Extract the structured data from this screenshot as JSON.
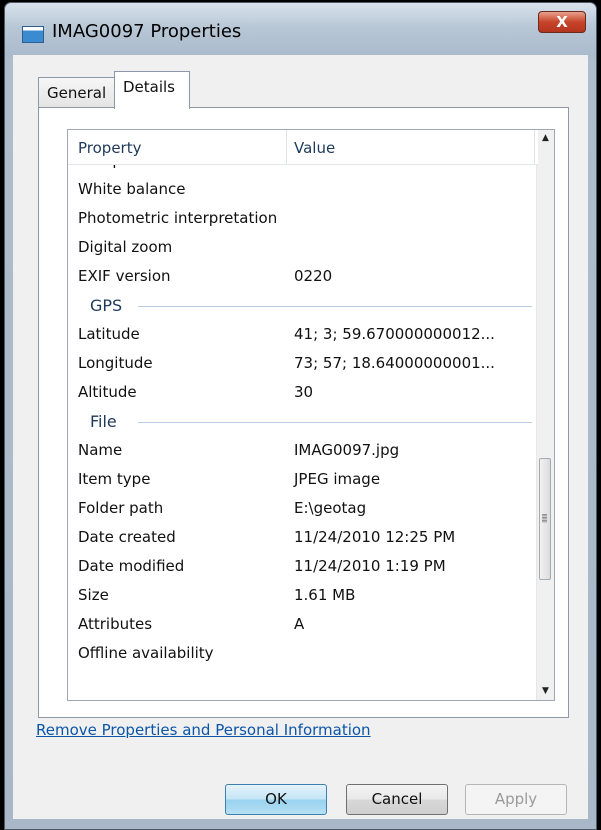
{
  "window": {
    "title": "IMAG0097 Properties",
    "close_label": "X"
  },
  "tabs": [
    {
      "label": "General"
    },
    {
      "label": "Details"
    }
  ],
  "list": {
    "headers": {
      "property": "Property",
      "value": "Value"
    },
    "rows": {
      "sharpness": {
        "property": "Sharpness",
        "value": ""
      },
      "white_balance": {
        "property": "White balance",
        "value": ""
      },
      "photometric": {
        "property": "Photometric interpretation",
        "value": ""
      },
      "digital_zoom": {
        "property": "Digital zoom",
        "value": ""
      },
      "exif_version": {
        "property": "EXIF version",
        "value": "0220"
      },
      "latitude": {
        "property": "Latitude",
        "value": "41; 3; 59.670000000012..."
      },
      "longitude": {
        "property": "Longitude",
        "value": "73; 57; 18.64000000001..."
      },
      "altitude": {
        "property": "Altitude",
        "value": "30"
      },
      "name": {
        "property": "Name",
        "value": "IMAG0097.jpg"
      },
      "item_type": {
        "property": "Item type",
        "value": "JPEG image"
      },
      "folder_path": {
        "property": "Folder path",
        "value": "E:\\geotag"
      },
      "date_created": {
        "property": "Date created",
        "value": "11/24/2010 12:25 PM"
      },
      "date_modified": {
        "property": "Date modified",
        "value": "11/24/2010 1:19 PM"
      },
      "size": {
        "property": "Size",
        "value": "1.61 MB"
      },
      "attributes": {
        "property": "Attributes",
        "value": "A"
      },
      "offline": {
        "property": "Offline availability",
        "value": ""
      }
    },
    "groups": {
      "gps": "GPS",
      "file": "File"
    }
  },
  "link_text": "Remove Properties and Personal Information",
  "buttons": {
    "ok": "OK",
    "cancel": "Cancel",
    "apply": "Apply"
  },
  "scrollbar": {
    "position_fraction": 0.75
  }
}
